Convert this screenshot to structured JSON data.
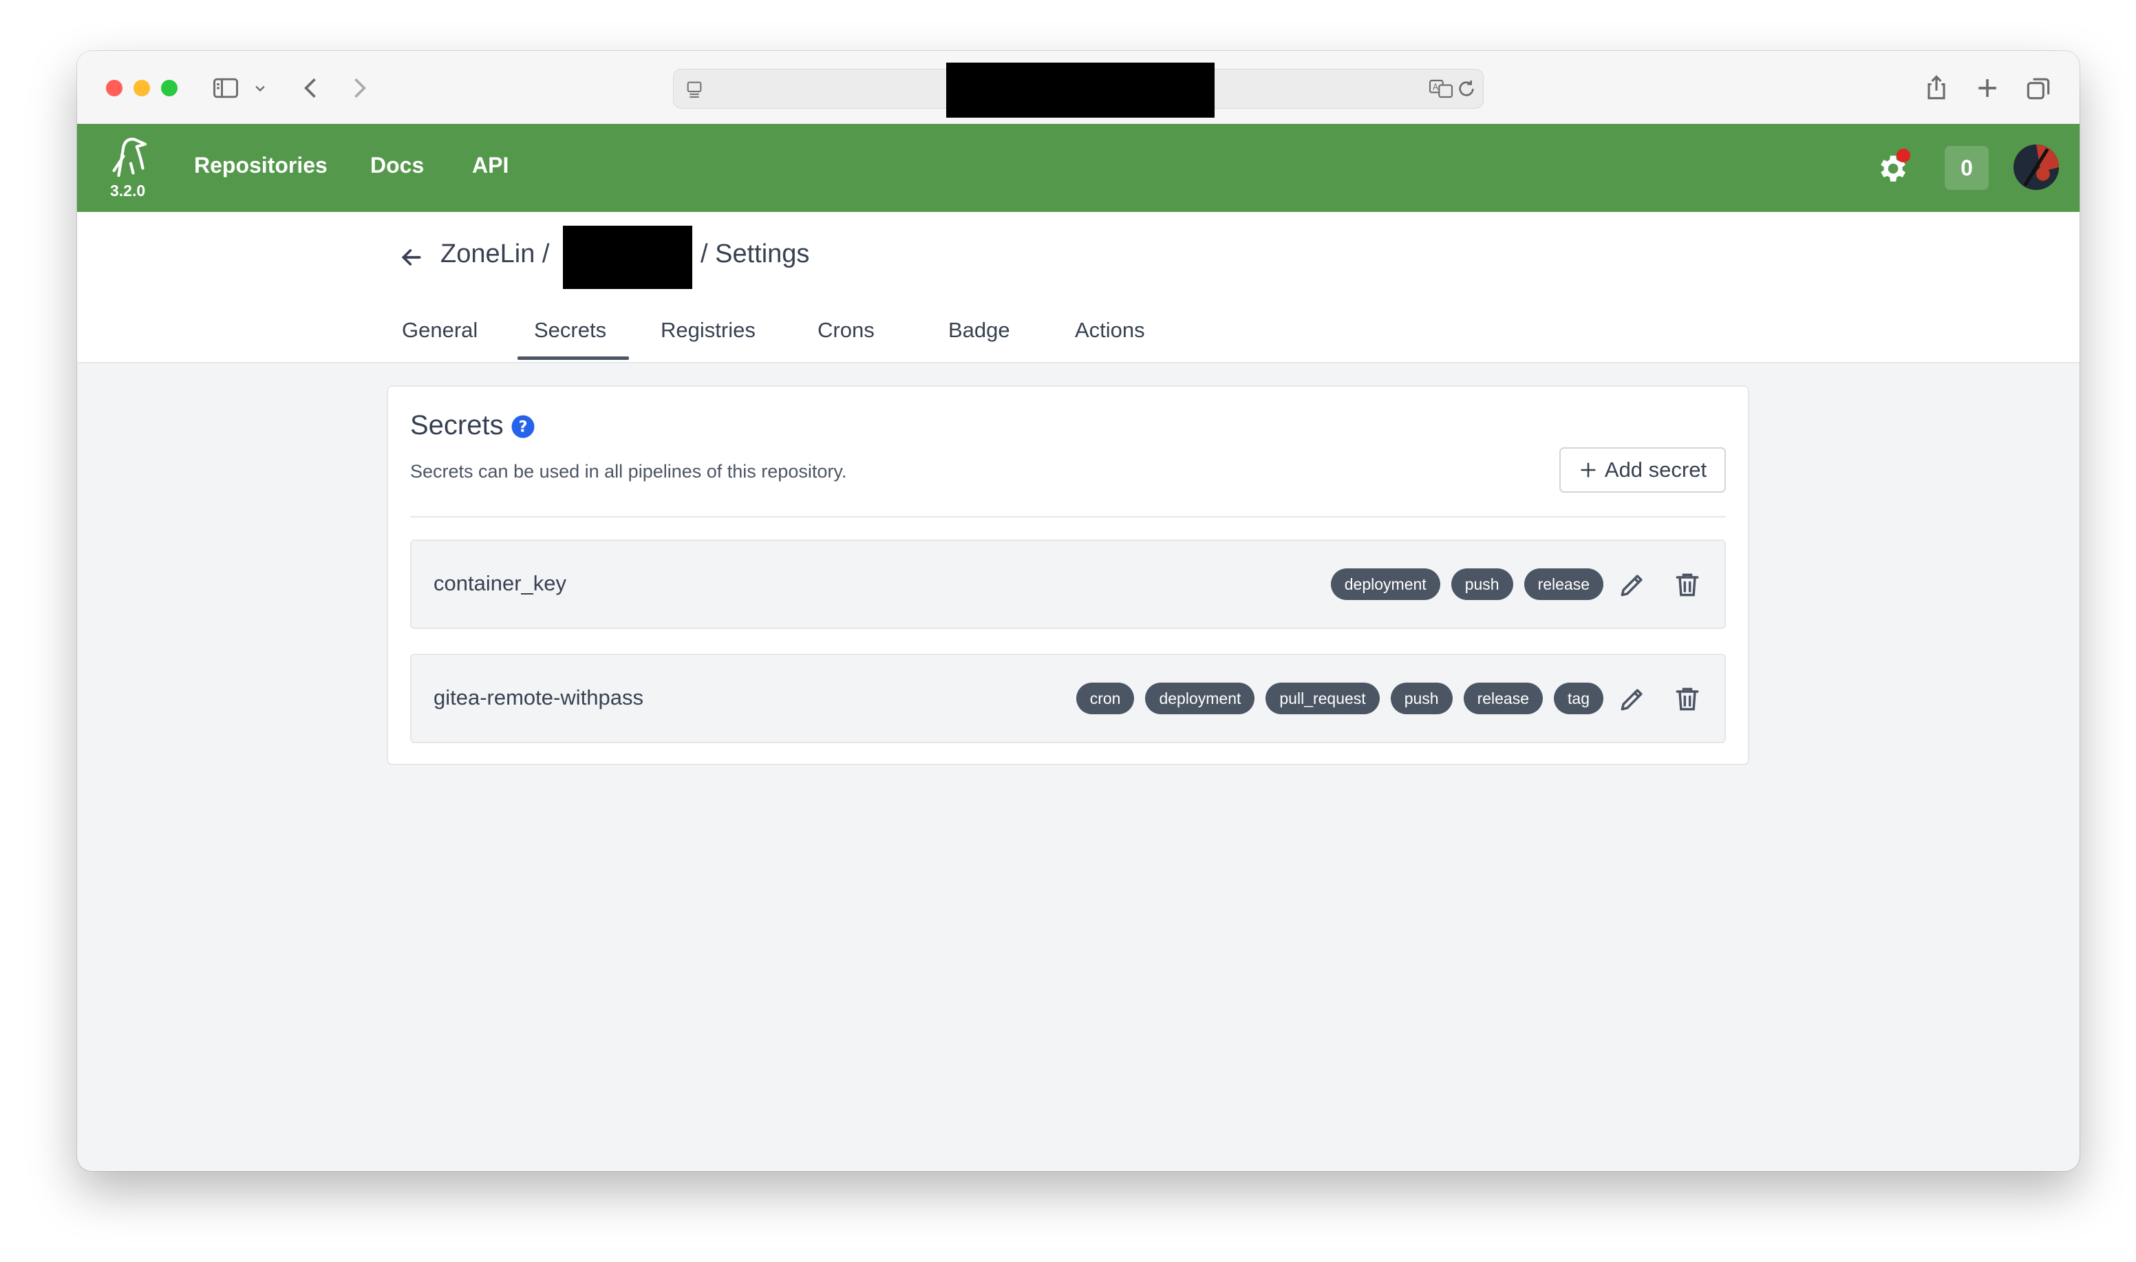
{
  "app": {
    "version": "3.2.0",
    "nav_links": [
      "Repositories",
      "Docs",
      "API"
    ],
    "notification_count": "0",
    "accent_color": "#54984c"
  },
  "breadcrumb": {
    "owner": "ZoneLin /",
    "suffix": "/ Settings"
  },
  "tabs": [
    "General",
    "Secrets",
    "Registries",
    "Crons",
    "Badge",
    "Actions"
  ],
  "active_tab": "Secrets",
  "secrets_panel": {
    "title": "Secrets",
    "description": "Secrets can be used in all pipelines of this repository.",
    "add_button_label": "Add secret",
    "secrets": [
      {
        "name": "container_key",
        "events": [
          "deployment",
          "push",
          "release"
        ]
      },
      {
        "name": "gitea-remote-withpass",
        "events": [
          "cron",
          "deployment",
          "pull_request",
          "push",
          "release",
          "tag"
        ]
      }
    ]
  },
  "icons": {
    "back": "arrow-left-icon",
    "help": "question-circle-icon",
    "add": "plus-icon",
    "edit": "pencil-icon",
    "delete": "trash-icon",
    "settings": "gear-icon"
  }
}
